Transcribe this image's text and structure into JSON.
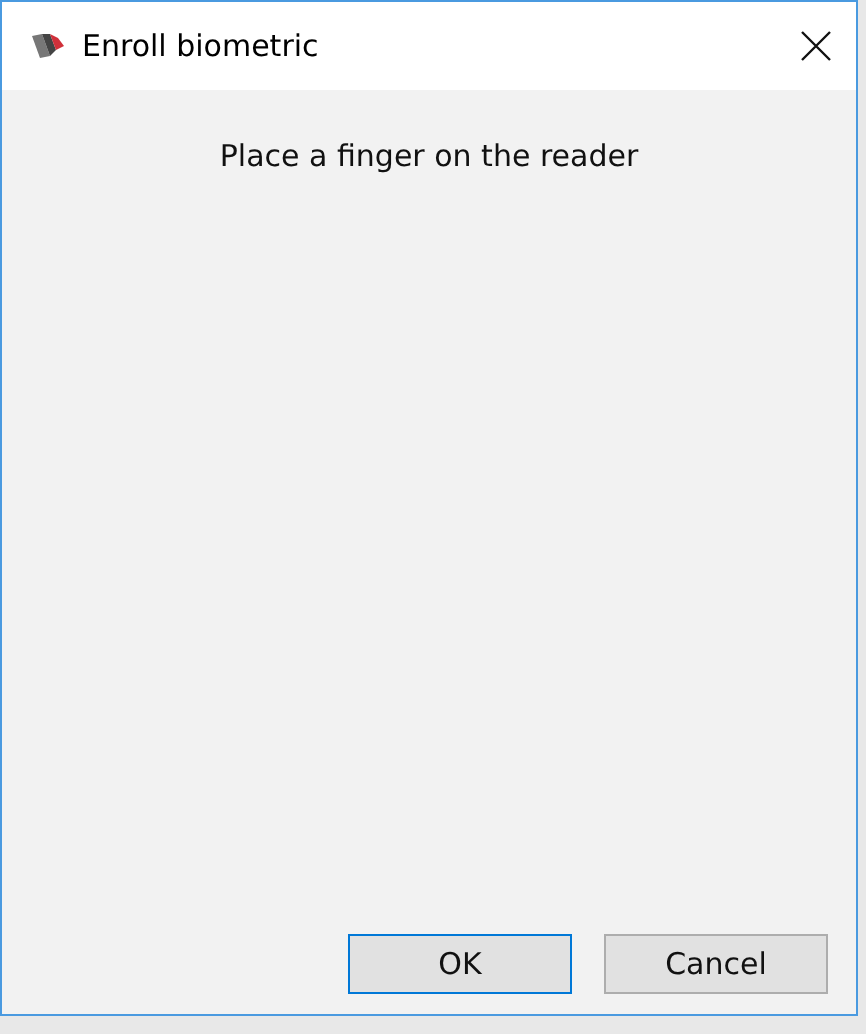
{
  "window": {
    "title": "Enroll biometric"
  },
  "message": "Place a finger on the reader",
  "buttons": [
    {
      "label": "OK",
      "default": true
    },
    {
      "label": "Cancel",
      "default": false
    }
  ]
}
